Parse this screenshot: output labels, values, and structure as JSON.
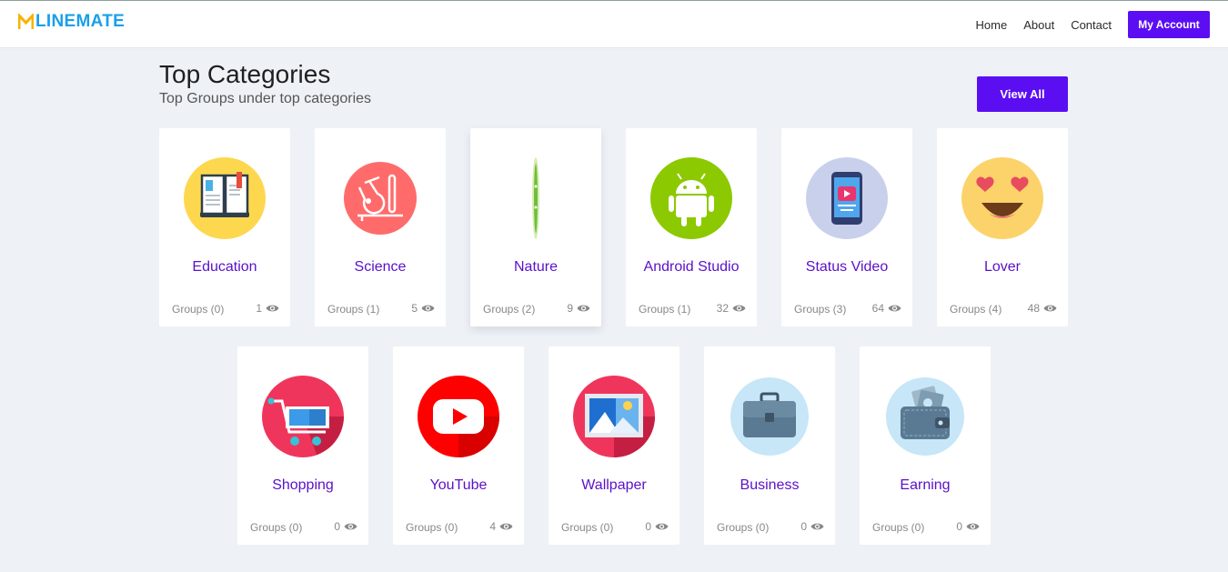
{
  "header": {
    "logo": "LINEMATE",
    "nav": [
      "Home",
      "About",
      "Contact"
    ],
    "account_button": "My Account"
  },
  "section": {
    "title": "Top Categories",
    "subtitle": "Top Groups under top categories",
    "view_all": "View All"
  },
  "categories": [
    {
      "name": "Education",
      "groups": "Groups (0)",
      "views": "1"
    },
    {
      "name": "Science",
      "groups": "Groups (1)",
      "views": "5"
    },
    {
      "name": "Nature",
      "groups": "Groups (2)",
      "views": "9"
    },
    {
      "name": "Android Studio",
      "groups": "Groups (1)",
      "views": "32"
    },
    {
      "name": "Status Video",
      "groups": "Groups (3)",
      "views": "64"
    },
    {
      "name": "Lover",
      "groups": "Groups (4)",
      "views": "48"
    },
    {
      "name": "Shopping",
      "groups": "Groups (0)",
      "views": "0"
    },
    {
      "name": "YouTube",
      "groups": "Groups (0)",
      "views": "4"
    },
    {
      "name": "Wallpaper",
      "groups": "Groups (0)",
      "views": "0"
    },
    {
      "name": "Business",
      "groups": "Groups (0)",
      "views": "0"
    },
    {
      "name": "Earning",
      "groups": "Groups (0)",
      "views": "0"
    }
  ],
  "colors": {
    "accent": "#5b0ef2",
    "category_text": "#5b10c8",
    "logo": "#1aa0e8"
  }
}
